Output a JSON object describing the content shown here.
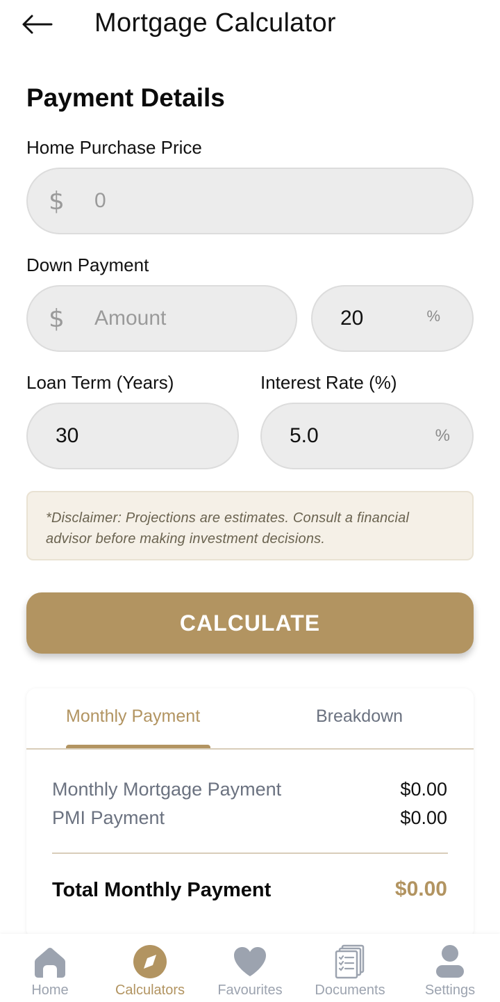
{
  "header": {
    "title": "Mortgage Calculator",
    "back_icon": "arrow-left-icon"
  },
  "section_title": "Payment Details",
  "fields": {
    "home_price": {
      "label": "Home Purchase Price",
      "prefix": "$",
      "placeholder": "0",
      "value": ""
    },
    "down_payment": {
      "label": "Down Payment",
      "amount_prefix": "$",
      "amount_placeholder": "Amount",
      "amount_value": "",
      "percent_value": "20",
      "percent_suffix": "%"
    },
    "loan_term": {
      "label": "Loan Term (Years)",
      "value": "30"
    },
    "interest_rate": {
      "label": "Interest Rate (%)",
      "value": "5.0",
      "suffix": "%"
    }
  },
  "disclaimer": "*Disclaimer: Projections are estimates. Consult a financial advisor before making investment decisions.",
  "calculate_label": "CALCULATE",
  "results": {
    "tabs": [
      {
        "label": "Monthly Payment",
        "active": true
      },
      {
        "label": "Breakdown",
        "active": false
      }
    ],
    "rows": [
      {
        "label": "Monthly Mortgage Payment",
        "value": "$0.00"
      },
      {
        "label": "PMI Payment",
        "value": "$0.00"
      }
    ],
    "total_label": "Total Monthly Payment",
    "total_value": "$0.00"
  },
  "nav": [
    {
      "label": "Home",
      "icon": "home-icon",
      "active": false
    },
    {
      "label": "Calculators",
      "icon": "compass-icon",
      "active": true
    },
    {
      "label": "Favourites",
      "icon": "heart-icon",
      "active": false
    },
    {
      "label": "Documents",
      "icon": "documents-icon",
      "active": false
    },
    {
      "label": "Settings",
      "icon": "user-icon",
      "active": false
    }
  ],
  "colors": {
    "accent": "#b29461",
    "field_bg": "#ececec",
    "muted": "#9ca3af",
    "disclaimer_bg": "#f5f0e7"
  }
}
